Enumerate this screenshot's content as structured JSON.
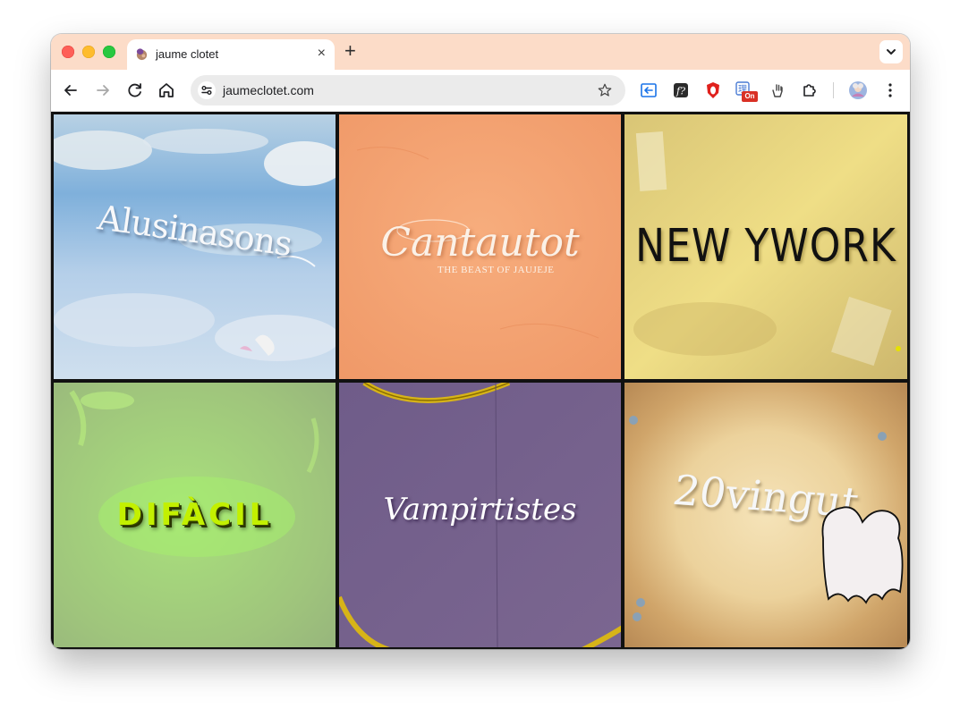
{
  "browser": {
    "tab_title": "jaume clotet",
    "new_tab_label": "+",
    "close_label": "×",
    "url": "jaumeclotet.com",
    "extension_badge": "On"
  },
  "grid": {
    "tiles": [
      {
        "title": "Alusinasons",
        "color": "#a9c8e6"
      },
      {
        "title": "Cantautot",
        "subtitle": "THE BEAST OF JAUJEJE",
        "color": "#f4a373"
      },
      {
        "title": "NEW YWORK",
        "color": "#e9d57a"
      },
      {
        "title": "DIFÀCIL",
        "color": "#9cc37a"
      },
      {
        "title": "Vampirtistes",
        "color": "#745f8a"
      },
      {
        "title": "20vingut",
        "color": "#d2a66a"
      }
    ]
  },
  "colors": {
    "tabbar": "#fcdcc8",
    "accent_red": "#d93025"
  }
}
